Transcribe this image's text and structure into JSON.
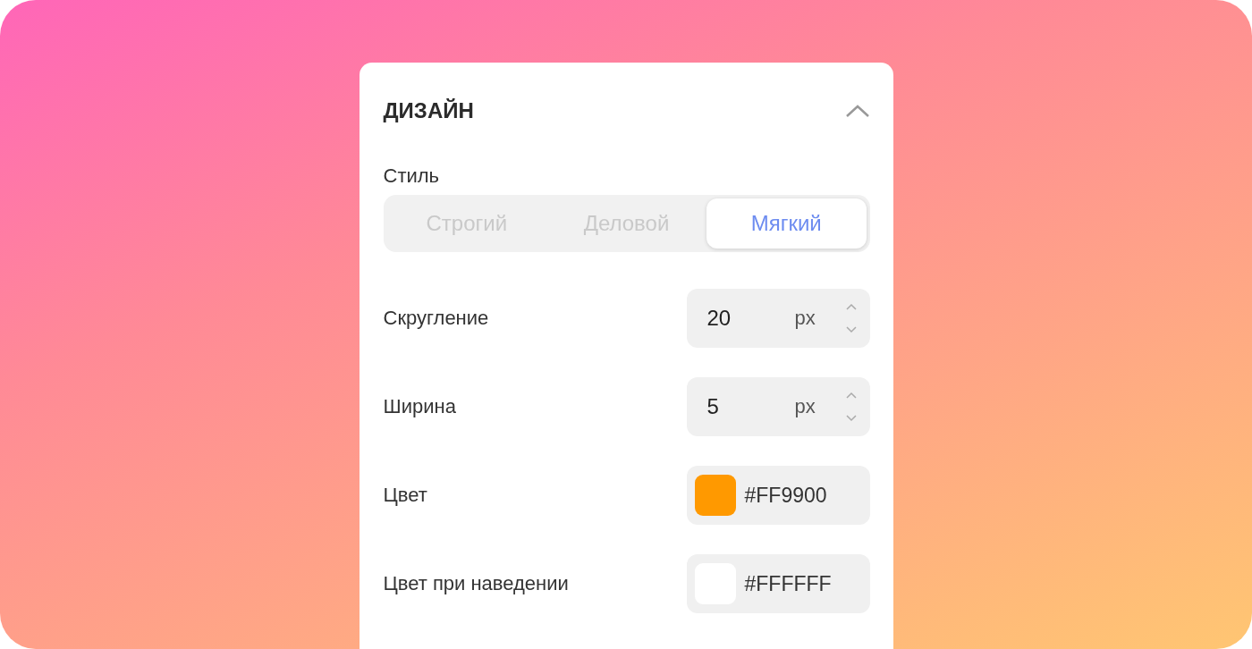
{
  "panel": {
    "title": "ДИЗАЙН",
    "expanded": true
  },
  "style": {
    "label": "Стиль",
    "options": [
      {
        "label": "Строгий",
        "selected": false
      },
      {
        "label": "Деловой",
        "selected": false
      },
      {
        "label": "Мягкий",
        "selected": true
      }
    ]
  },
  "fields": [
    {
      "kind": "number",
      "label": "Скругление",
      "value": "20",
      "unit": "px"
    },
    {
      "kind": "number",
      "label": "Ширина",
      "value": "5",
      "unit": "px"
    },
    {
      "kind": "color",
      "label": "Цвет",
      "value": "#FF9900",
      "color": "#ff9900"
    },
    {
      "kind": "color",
      "label": "Цвет при наведении",
      "value": "#FFFFFF",
      "color": "#ffffff"
    }
  ]
}
